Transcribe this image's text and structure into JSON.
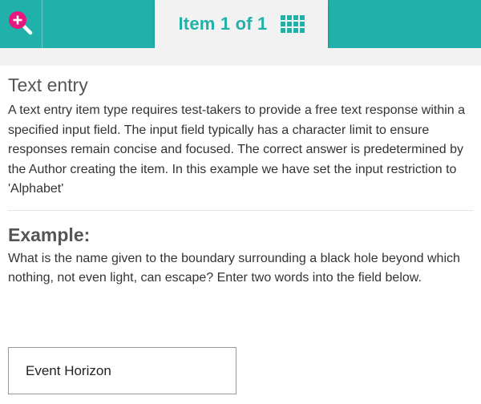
{
  "header": {
    "zoom_icon": "zoom-in-icon",
    "item_counter": "Item 1 of 1",
    "grid_icon": "grid-icon",
    "accent_color": "#20b2aa",
    "zoom_icon_color": "#e6177d"
  },
  "section": {
    "title": "Text entry",
    "description": "A text entry item type requires test-takers to provide a free text response within a specified input field. The input field typically has a character limit to ensure responses remain concise and focused. The correct answer is predetermined by the Author creating the item. In this example we have set the input restriction to 'Alphabet'"
  },
  "example": {
    "title": "Example:",
    "question": "What is the name given to the boundary surrounding a black hole beyond which nothing, not even light, can escape? Enter two words into the field below.",
    "answer_value": "Event Horizon"
  }
}
